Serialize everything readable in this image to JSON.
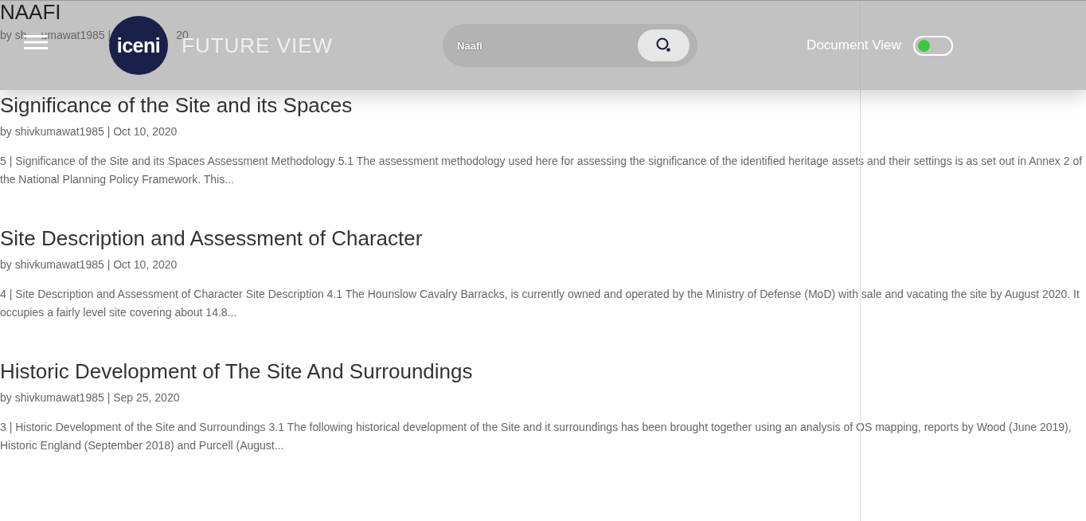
{
  "header": {
    "logo_text": "iceni",
    "brand": "FUTURE VIEW",
    "search": {
      "value": "Naafi"
    },
    "toggle": {
      "label": "Document View",
      "on": false
    }
  },
  "first_post": {
    "title": "NAAFI",
    "meta_parts": [
      "by sh",
      "umawat1985 |",
      "20"
    ]
  },
  "posts": [
    {
      "title": "Significance of the Site and its Spaces",
      "meta": "by shivkumawat1985 | Oct 10, 2020",
      "excerpt": "5 | Significance of the Site and its Spaces Assessment Methodology 5.1 The assessment methodology used here for assessing the significance of the identified heritage assets and their settings is as set out in Annex 2 of the National Planning Policy Framework. This..."
    },
    {
      "title": "Site Description and Assessment of Character",
      "meta": "by shivkumawat1985 | Oct 10, 2020",
      "excerpt": "4 | Site Description and Assessment of Character Site Description 4.1 The Hounslow Cavalry Barracks, is currently owned and operated by the Ministry of Defense (MoD) with sale and vacating the site by August 2020. It occupies a fairly level site covering about 14.8..."
    },
    {
      "title": "Historic Development of The Site And Surroundings",
      "meta": "by shivkumawat1985 | Sep 25, 2020",
      "excerpt": "3 | Historic Development of the Site and Surroundings 3.1 The following historical development of the Site and it surroundings has been brought together using an analysis of OS mapping, reports by Wood (June 2019), Historic England (September 2018) and Purcell (August..."
    }
  ]
}
